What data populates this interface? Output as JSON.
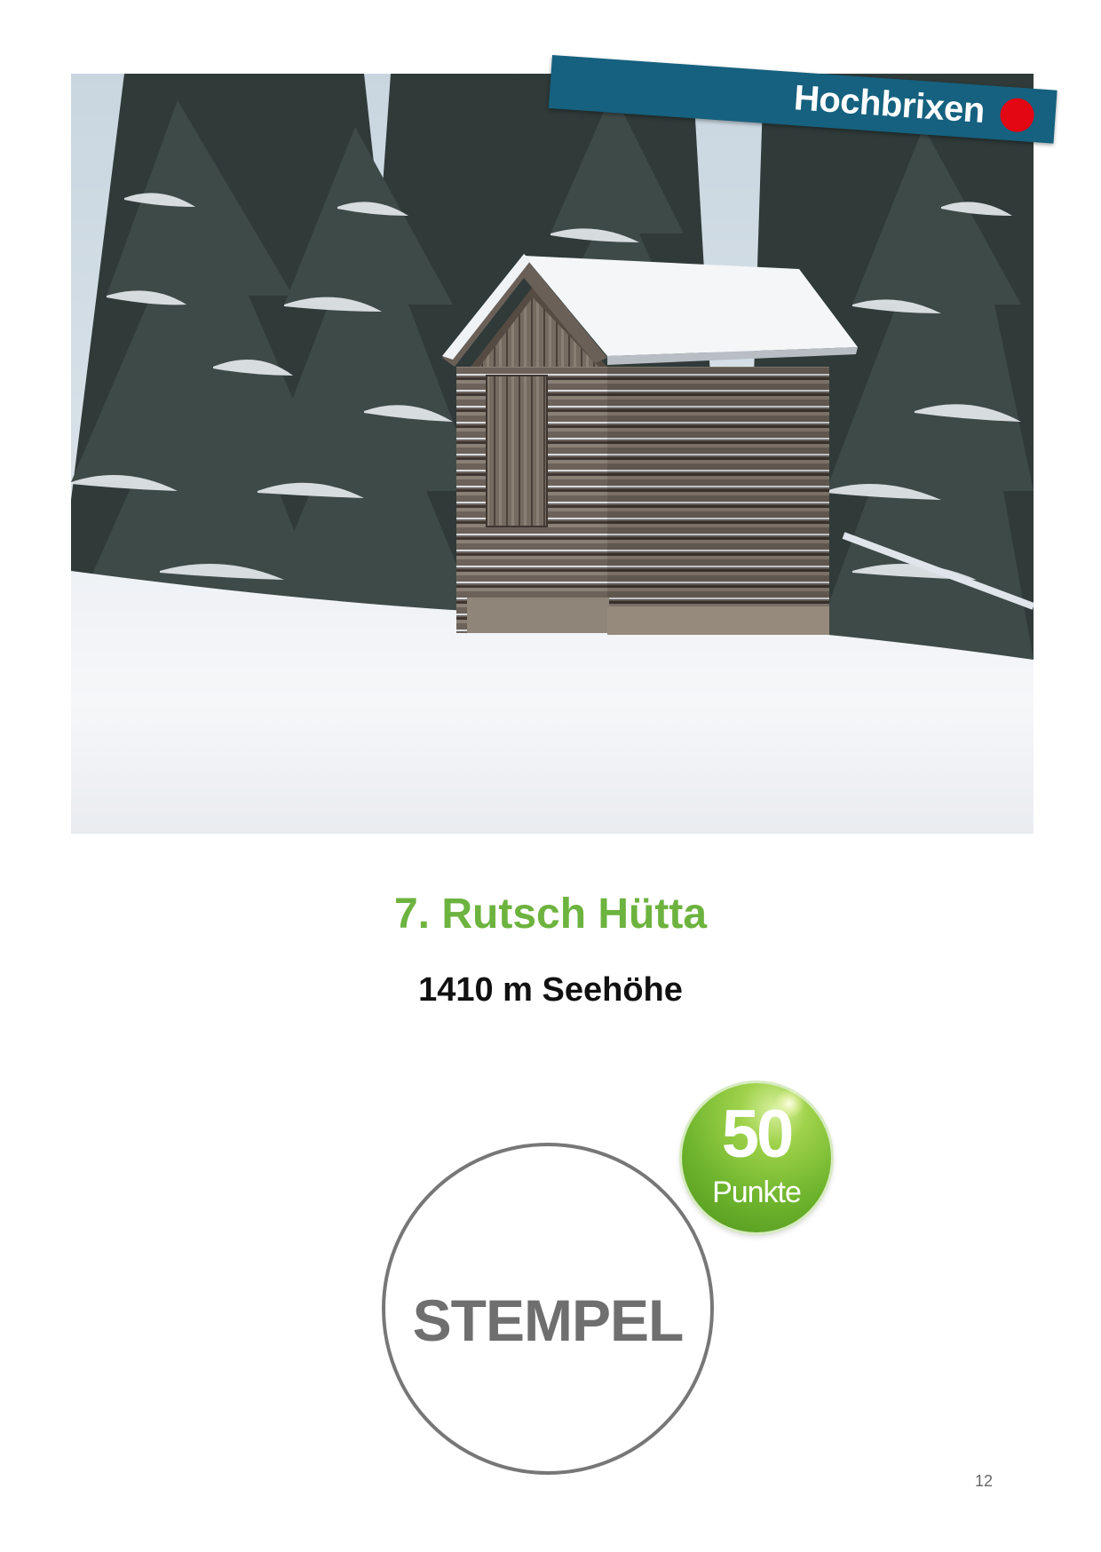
{
  "banner": {
    "label": "Hochbrixen",
    "dot_color": "#e30613",
    "background_color": "#15617f"
  },
  "photo": {
    "subject": "snow-covered-log-hut-in-forest"
  },
  "heading": {
    "title": "7. Rutsch Hütta",
    "title_color": "#6db33f",
    "altitude": "1410 m Seehöhe"
  },
  "stamp": {
    "label": "STEMPEL"
  },
  "points_badge": {
    "value": "50",
    "label": "Punkte",
    "color": "#6eb42d"
  },
  "footer": {
    "page_number": "12"
  }
}
